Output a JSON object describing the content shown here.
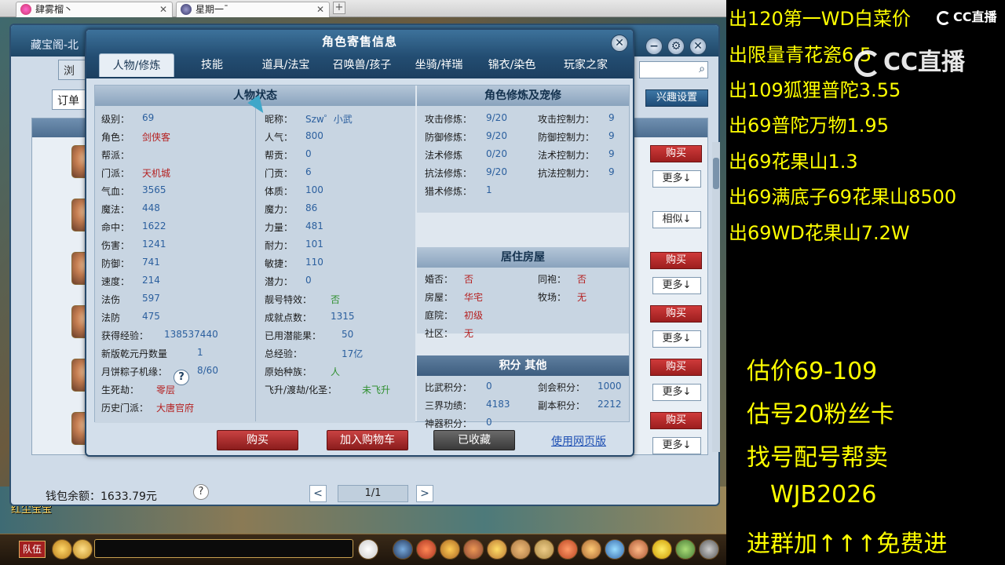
{
  "browser": {
    "tabs": [
      {
        "title": "肆雾榴丶"
      },
      {
        "title": "星期一ˉ"
      }
    ]
  },
  "market": {
    "title": "藏宝阁-北",
    "browse_label": "浏",
    "order_label": "订单",
    "interest_label": "兴趣设置",
    "buy_label": "购买",
    "more_label": "更多↓",
    "similar_label": "相似↓",
    "wallet_label": "钱包余额：1633.79元",
    "help_label": "?",
    "page_label": "1/1",
    "prev_label": "<",
    "next_label": ">"
  },
  "detail": {
    "title": "角色寄售信息",
    "close_label": "✕",
    "tabs": [
      {
        "label": "人物/修炼"
      },
      {
        "label": "技能"
      },
      {
        "label": "道具/法宝"
      },
      {
        "label": "召唤兽/孩子"
      },
      {
        "label": "坐骑/祥瑞"
      },
      {
        "label": "锦衣/染色"
      },
      {
        "label": "玩家之家"
      }
    ],
    "status": {
      "header": "人物状态",
      "col1": [
        {
          "label": "级别：",
          "value": "69"
        },
        {
          "label": "角色：",
          "value": "剑侠客"
        },
        {
          "label": "帮派：",
          "value": ""
        },
        {
          "label": "门派：",
          "value": "天机城"
        },
        {
          "label": "气血：",
          "value": "3565"
        },
        {
          "label": "魔法：",
          "value": "448"
        },
        {
          "label": "命中：",
          "value": "1622"
        },
        {
          "label": "伤害：",
          "value": "1241"
        },
        {
          "label": "防御：",
          "value": "741"
        },
        {
          "label": "速度：",
          "value": "214"
        },
        {
          "label": "法伤",
          "value": "597"
        },
        {
          "label": "法防",
          "value": "475"
        },
        {
          "label": "获得经验：",
          "value": "138537440"
        },
        {
          "label": "新版乾元丹数量",
          "value": "1"
        },
        {
          "label": "月饼粽子机缘：",
          "value": "8/60"
        },
        {
          "label": "生死劫：",
          "value": "零层"
        },
        {
          "label": "历史门派：",
          "value": "大唐官府"
        }
      ],
      "col2": [
        {
          "label": "昵称：",
          "value": "Szw゜小武"
        },
        {
          "label": "人气：",
          "value": "800"
        },
        {
          "label": "帮贡：",
          "value": "0"
        },
        {
          "label": "门贡：",
          "value": "6"
        },
        {
          "label": "体质：",
          "value": "100"
        },
        {
          "label": "魔力：",
          "value": "86"
        },
        {
          "label": "力量：",
          "value": "481"
        },
        {
          "label": "耐力：",
          "value": "101"
        },
        {
          "label": "敏捷：",
          "value": "110"
        },
        {
          "label": "潜力：",
          "value": "0"
        },
        {
          "label": "靓号特效：",
          "value": "否"
        },
        {
          "label": "成就点数：",
          "value": "1315"
        },
        {
          "label": "已用潜能果：",
          "value": "50"
        },
        {
          "label": "总经验：",
          "value": "17亿"
        },
        {
          "label": "原始种族：",
          "value": "人"
        },
        {
          "label": "飞升/渡劫/化圣：",
          "value": "未飞升"
        }
      ]
    },
    "cultivation": {
      "header": "角色修炼及宠修",
      "rows": [
        {
          "l1": "攻击修炼：",
          "v1": "9/20",
          "l2": "攻击控制力：",
          "v2": "9"
        },
        {
          "l1": "防御修炼：",
          "v1": "9/20",
          "l2": "防御控制力：",
          "v2": "9"
        },
        {
          "l1": "法术修炼",
          "v1": "0/20",
          "l2": "法术控制力：",
          "v2": "9"
        },
        {
          "l1": "抗法修炼：",
          "v1": "9/20",
          "l2": "抗法控制力：",
          "v2": "9"
        },
        {
          "l1": "猎术修炼：",
          "v1": "1",
          "l2": "",
          "v2": ""
        }
      ]
    },
    "house": {
      "header": "居住房屋",
      "rows": [
        {
          "l1": "婚否：",
          "v1": "否",
          "l2": "同袍：",
          "v2": "否"
        },
        {
          "l1": "房屋：",
          "v1": "华宅",
          "l2": "牧场：",
          "v2": "无"
        },
        {
          "l1": "庭院：",
          "v1": "初级",
          "l2": "",
          "v2": ""
        },
        {
          "l1": "社区：",
          "v1": "无",
          "l2": "",
          "v2": ""
        }
      ]
    },
    "points": {
      "header": "积分 其他",
      "rows": [
        {
          "l1": "比武积分：",
          "v1": "0",
          "l2": "剑会积分：",
          "v2": "1000"
        },
        {
          "l1": "三界功绩：",
          "v1": "4183",
          "l2": "副本积分：",
          "v2": "2212"
        },
        {
          "l1": "神器积分：",
          "v1": "0",
          "l2": "",
          "v2": ""
        }
      ]
    },
    "buttons": {
      "buy": "购买",
      "add_cart": "加入购物车",
      "favorited": "已收藏",
      "web_version": "使用网页版"
    }
  },
  "game": {
    "team_label": "队伍",
    "floor_text": "红尘宝宝"
  },
  "overlay": {
    "lines": [
      "出120第一WD白菜价",
      "出限量青花瓷6.5",
      "出109狐狸普陀3.55",
      "出69普陀万物1.95",
      "出69花果山1.3",
      "出69满底子69花果山8500",
      "出69WD花果山7.2W"
    ],
    "bottom_lines": [
      "估价69-109",
      "估号20粉丝卡",
      "找号配号帮卖",
      "WJB2026",
      "进群加↑↑↑免费进"
    ],
    "logo_small": "CC直播",
    "logo_big": "CC直播"
  }
}
